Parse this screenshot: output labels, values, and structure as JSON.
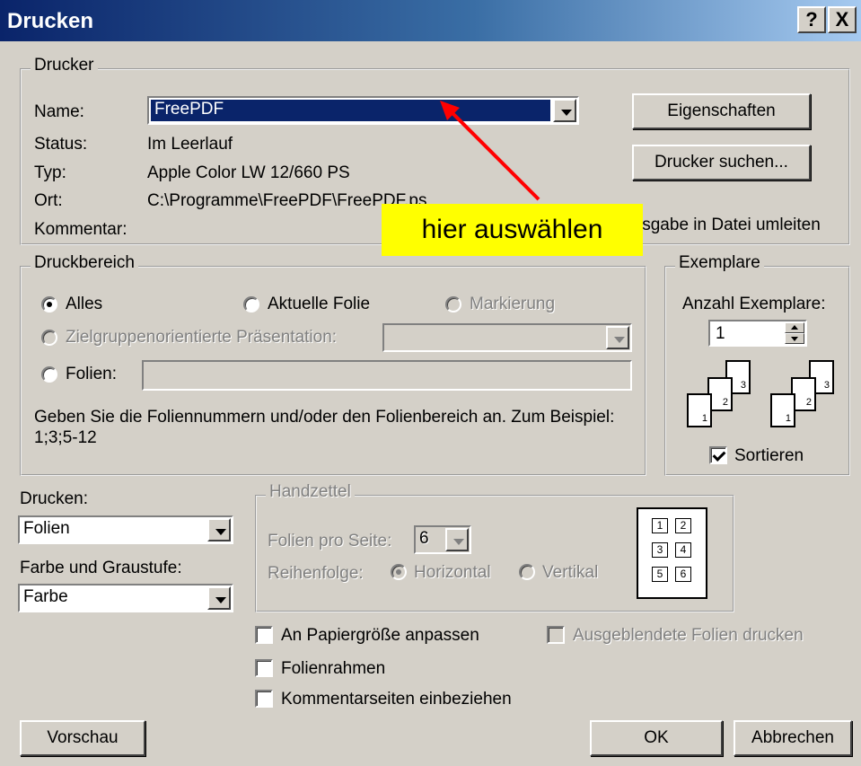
{
  "window": {
    "title": "Drucken",
    "help_button": "?",
    "close_button": "X"
  },
  "printer": {
    "legend": "Drucker",
    "name_label": "Name:",
    "name_value": "FreePDF",
    "status_label": "Status:",
    "status_value": "Im Leerlauf",
    "type_label": "Typ:",
    "type_value": "Apple Color LW 12/660 PS",
    "location_label": "Ort:",
    "location_value": "C:\\Programme\\FreePDF\\FreePDF.ps",
    "comment_label": "Kommentar:",
    "properties_button": "Eigenschaften",
    "find_printer_button": "Drucker suchen...",
    "print_to_file_label": "Ausgabe in Datei umleiten"
  },
  "annotation": {
    "callout_text": "hier auswählen",
    "colors": {
      "arrow": "#ff0000",
      "box": "#ffff00"
    }
  },
  "print_range": {
    "legend": "Druckbereich",
    "all_label": "Alles",
    "current_slide_label": "Aktuelle Folie",
    "selection_label": "Markierung",
    "custom_show_label": "Zielgruppenorientierte Präsentation:",
    "custom_show_value": "",
    "slides_label": "Folien:",
    "slides_value": "",
    "hint": "Geben Sie die Foliennummern und/oder den Folienbereich an. Zum Beispiel: 1;3;5-12",
    "selected": "all"
  },
  "copies": {
    "legend": "Exemplare",
    "count_label": "Anzahl Exemplare:",
    "count_value": "1",
    "collate_label": "Sortieren",
    "collate_checked": true,
    "stack_pages": [
      "1",
      "2",
      "3"
    ]
  },
  "print_what": {
    "label": "Drucken:",
    "value": "Folien"
  },
  "color": {
    "label": "Farbe und Graustufe:",
    "value": "Farbe"
  },
  "handouts": {
    "legend": "Handzettel",
    "per_page_label": "Folien pro Seite:",
    "per_page_value": "6",
    "order_label": "Reihenfolge:",
    "horizontal_label": "Horizontal",
    "vertical_label": "Vertikal",
    "preview_cells": [
      "1",
      "2",
      "3",
      "4",
      "5",
      "6"
    ]
  },
  "options": {
    "scale_to_fit_label": "An Papiergröße anpassen",
    "print_hidden_label": "Ausgeblendete Folien drucken",
    "frame_slides_label": "Folienrahmen",
    "include_comments_label": "Kommentarseiten einbeziehen"
  },
  "footer": {
    "preview_button": "Vorschau",
    "ok_button": "OK",
    "cancel_button": "Abbrechen"
  }
}
